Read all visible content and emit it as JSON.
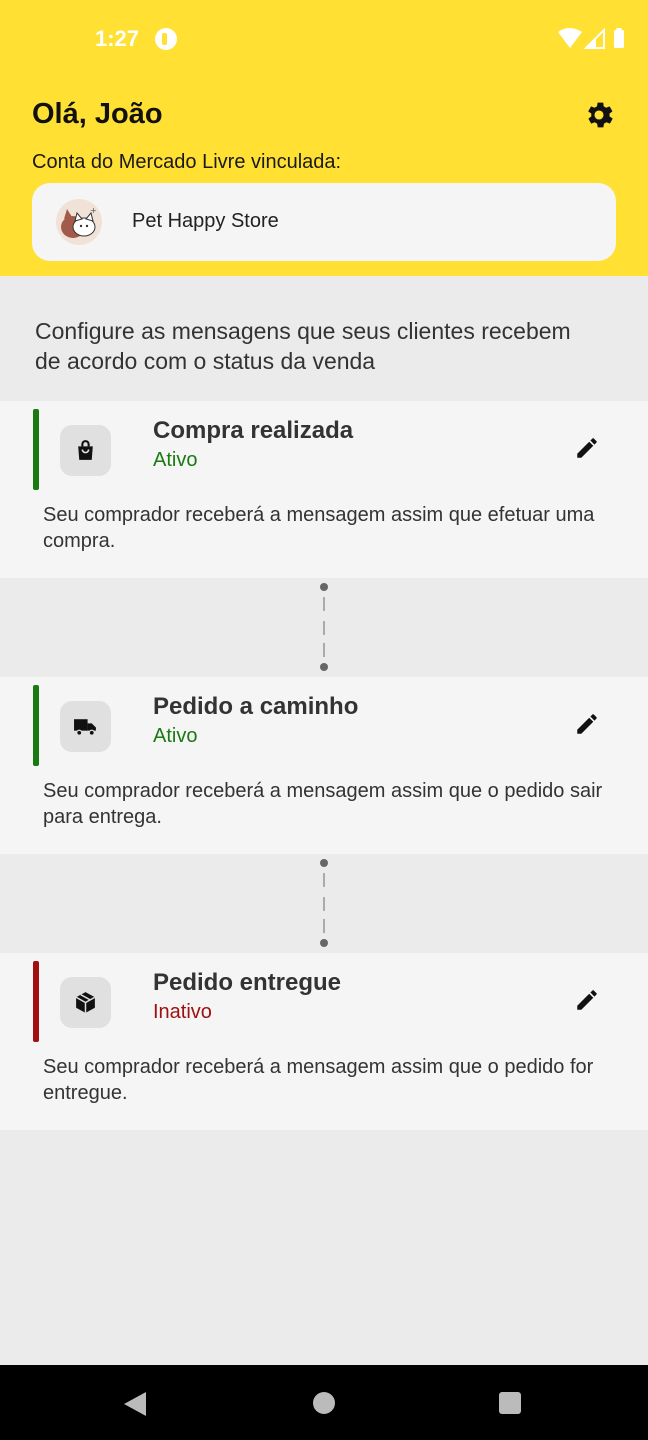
{
  "status_bar": {
    "time": "1:27"
  },
  "header": {
    "greeting": "Olá, João",
    "account_label": "Conta do Mercado Livre vinculada:",
    "store_name": "Pet Happy Store"
  },
  "intro": "Configure as mensagens que seus clientes recebem de acordo com o status da venda",
  "cards": [
    {
      "title": "Compra realizada",
      "status": "Ativo",
      "description": "Seu comprador receberá a mensagem assim que efetuar uma compra.",
      "icon": "shopping-bag-icon",
      "status_color": "#1a7a12"
    },
    {
      "title": "Pedido a caminho",
      "status": "Ativo",
      "description": "Seu comprador receberá a mensagem assim que o pedido sair para entrega.",
      "icon": "truck-icon",
      "status_color": "#1a7a12"
    },
    {
      "title": "Pedido entregue",
      "status": "Inativo",
      "description": "Seu comprador receberá a mensagem assim que o pedido for entregue.",
      "icon": "package-icon",
      "status_color": "#a01010"
    }
  ],
  "colors": {
    "header_bg": "#ffe033",
    "active": "#1a7a12",
    "inactive": "#a01010"
  }
}
